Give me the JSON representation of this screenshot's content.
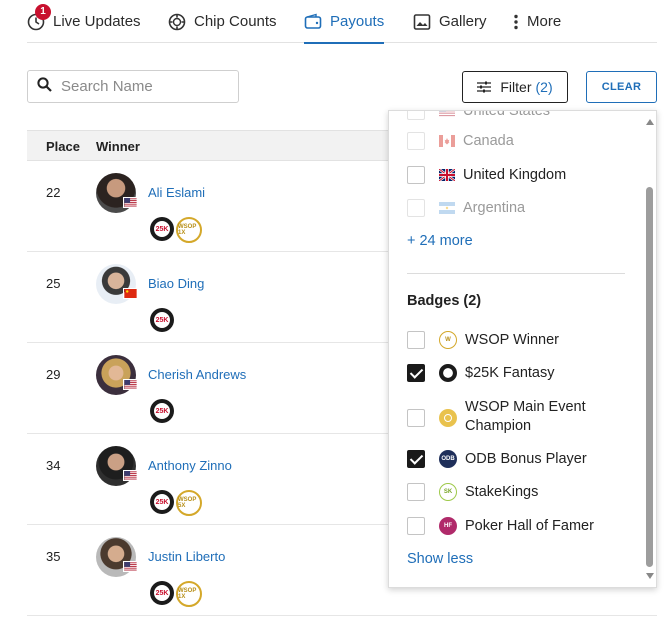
{
  "tabs": [
    {
      "label": "Live Updates",
      "icon": "clock-icon",
      "badge": "1"
    },
    {
      "label": "Chip Counts",
      "icon": "poker-chip-icon"
    },
    {
      "label": "Payouts",
      "icon": "wallet-icon",
      "active": true
    },
    {
      "label": "Gallery",
      "icon": "image-icon"
    },
    {
      "label": "More",
      "icon": "vertical-dots-icon"
    }
  ],
  "search": {
    "placeholder": "Search Name",
    "value": ""
  },
  "filter_button": {
    "label": "Filter",
    "count": "(2)"
  },
  "clear_button": {
    "label": "CLEAR"
  },
  "table": {
    "headers": {
      "place": "Place",
      "winner": "Winner"
    },
    "rows": [
      {
        "place": "22",
        "name": "Ali Eslami",
        "flag": "us",
        "badges": [
          "25K",
          "WSOP 1X"
        ]
      },
      {
        "place": "25",
        "name": "Biao Ding",
        "flag": "cn",
        "badges": [
          "25K"
        ]
      },
      {
        "place": "29",
        "name": "Cherish Andrews",
        "flag": "us",
        "badges": [
          "25K"
        ]
      },
      {
        "place": "34",
        "name": "Anthony Zinno",
        "flag": "us",
        "badges": [
          "25K",
          "WSOP 5X"
        ]
      },
      {
        "place": "35",
        "name": "Justin Liberto",
        "flag": "us",
        "badges": [
          "25K",
          "WSOP 1X"
        ]
      }
    ]
  },
  "dropdown": {
    "countries": [
      {
        "label": "United States",
        "flag": "us",
        "disabled": true,
        "checked": false
      },
      {
        "label": "Canada",
        "flag": "ca",
        "disabled": true,
        "checked": false
      },
      {
        "label": "United Kingdom",
        "flag": "gb",
        "disabled": false,
        "checked": false
      },
      {
        "label": "Argentina",
        "flag": "ar",
        "disabled": true,
        "checked": false
      }
    ],
    "more_link": "+ 24 more",
    "badges_heading": "Badges (2)",
    "badges": [
      {
        "label": "WSOP Winner",
        "icon": "wsop-winner-icon",
        "checked": false
      },
      {
        "label": "$25K Fantasy",
        "icon": "fantasy-chip-icon",
        "checked": true
      },
      {
        "label": "WSOP Main Event",
        "label2": "Champion",
        "icon": "main-event-icon",
        "checked": false
      },
      {
        "label": "ODB Bonus Player",
        "icon": "odb-icon",
        "checked": true
      },
      {
        "label": "StakeKings",
        "icon": "stakekings-icon",
        "checked": false
      },
      {
        "label": "Poker Hall of Famer",
        "icon": "hall-of-fame-icon",
        "checked": false
      }
    ],
    "show_less": "Show less"
  },
  "colors": {
    "accent": "#1f6eb8",
    "notification": "#c8102e",
    "header_bg": "#f2f2f2"
  }
}
